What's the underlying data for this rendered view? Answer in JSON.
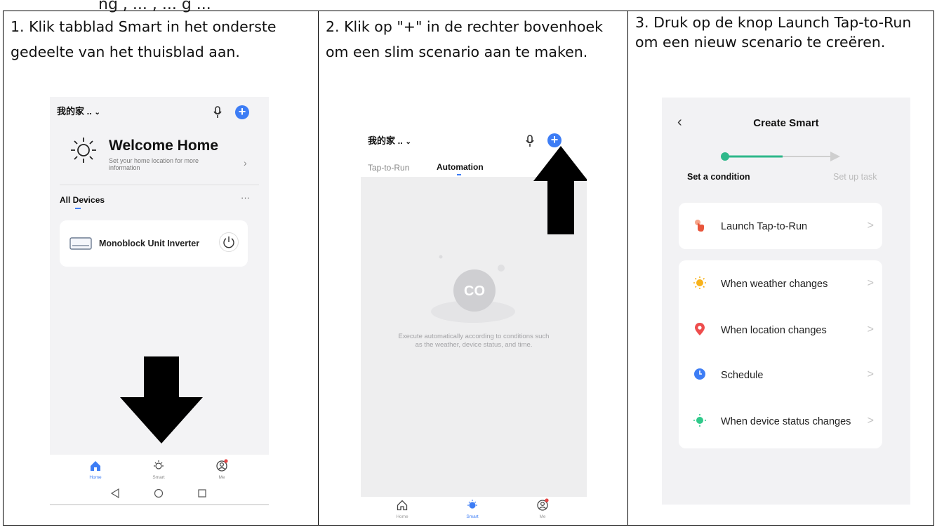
{
  "top_fragment": "ng                                         , ... , ...         g ...",
  "steps": [
    {
      "caption": "1. Klik tabblad Smart in het onderste gedeelte van het thuisblad aan."
    },
    {
      "caption": "2. Klik op \"+\" in de rechter bovenhoek om een slim scenario aan te maken."
    },
    {
      "caption": "3. Druk op de knop Launch Tap-to-Run om een nieuw scenario te creëren."
    }
  ],
  "screen1": {
    "home_name": "我的家 ..",
    "welcome_title": "Welcome Home",
    "welcome_sub": "Set your home location for more information",
    "section_title": "All Devices",
    "more": "···",
    "device_name": "Monoblock Unit Inverter",
    "nav": [
      "Home",
      "Smart",
      "Me"
    ],
    "icons": [
      "chevron-down-icon",
      "microphone-icon",
      "plus-icon",
      "sun-icon",
      "chevron-right-icon",
      "air-conditioner-icon",
      "power-icon",
      "home-icon",
      "smart-icon",
      "me-icon",
      "back-icon",
      "circle-home-icon",
      "recents-icon"
    ]
  },
  "screen2": {
    "home_name": "我的家 ..",
    "tabs": [
      "Tap-to-Run",
      "Automation"
    ],
    "empty_text": "Execute automatically according to conditions such as the weather, device status, and time.",
    "nav": [
      "Home",
      "Smart",
      "Me"
    ]
  },
  "screen3": {
    "title": "Create Smart",
    "step_left": "Set a condition",
    "step_right": "Set up task",
    "launch": "Launch Tap-to-Run",
    "options": [
      "When weather changes",
      "When location changes",
      "Schedule",
      "When device status changes"
    ],
    "accent": "#2fb88a",
    "chevron": ">"
  },
  "colors": {
    "blue": "#3d7df5",
    "red_dot": "#e64646"
  }
}
